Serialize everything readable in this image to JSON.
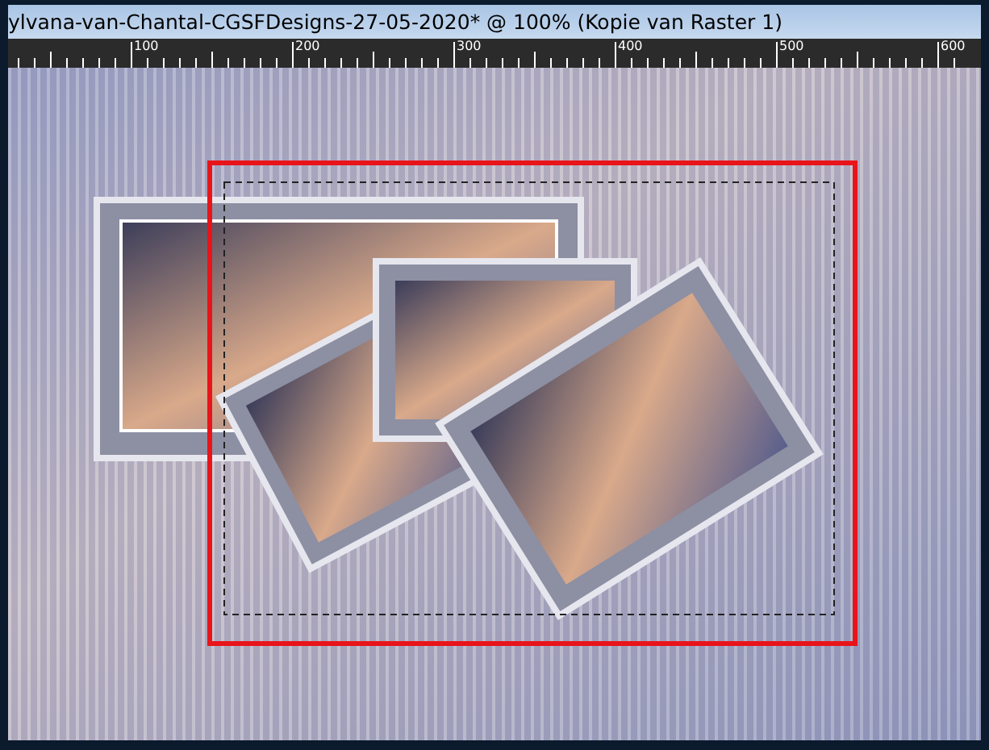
{
  "window": {
    "title": "ylvana-van-Chantal-CGSFDesigns-27-05-2020* @ 100% (Kopie van Raster 1)"
  },
  "ruler": {
    "labels": [
      "100",
      "200",
      "300",
      "400",
      "500",
      "600"
    ]
  }
}
